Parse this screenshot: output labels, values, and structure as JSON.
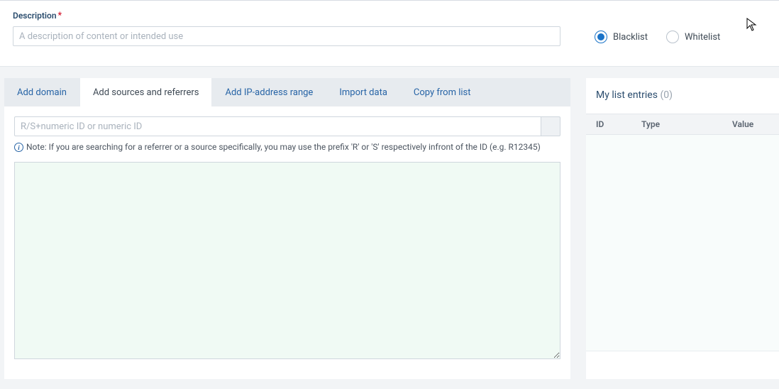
{
  "description": {
    "label": "Description",
    "required_mark": "*",
    "placeholder": "A description of content or intended use",
    "value": ""
  },
  "listType": {
    "options": {
      "blacklist": "Blacklist",
      "whitelist": "Whitelist"
    },
    "selected": "blacklist"
  },
  "tabs": {
    "addDomain": "Add domain",
    "addSources": "Add sources and referrers",
    "addIpRange": "Add IP-address range",
    "importData": "Import data",
    "copyFrom": "Copy from list",
    "active": "addSources"
  },
  "sourceSearch": {
    "placeholder": "R/S+numeric ID or numeric ID",
    "value": "",
    "noteLabel": "Note: ",
    "noteText": "If you are searching for a referrer or a source specifically, you may use the prefix 'R' or 'S' respectively infront of the ID (e.g. R12345)"
  },
  "results": {
    "value": ""
  },
  "entries": {
    "titlePrefix": "My list entries",
    "count": 0,
    "columns": {
      "id": "ID",
      "type": "Type",
      "value": "Value"
    },
    "rows": []
  }
}
